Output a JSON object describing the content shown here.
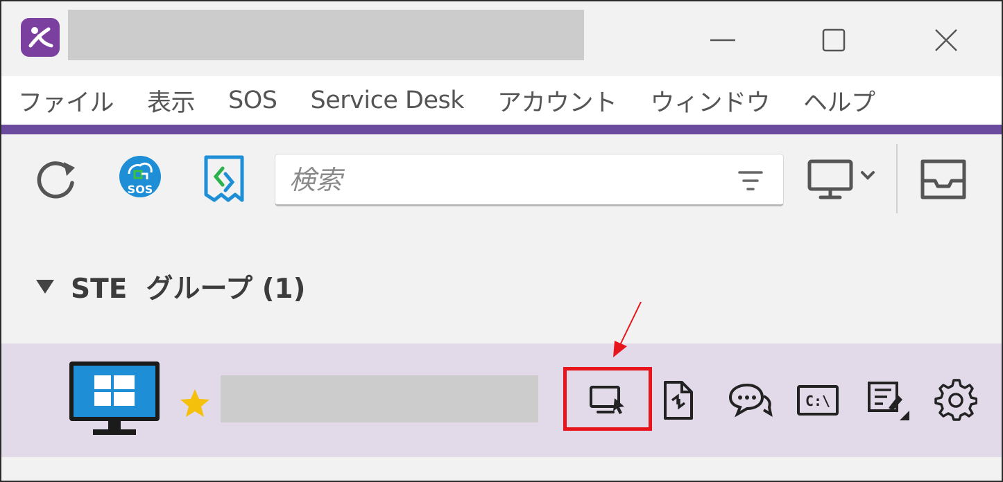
{
  "menu": {
    "items": [
      "ファイル",
      "表示",
      "SOS",
      "Service Desk",
      "アカウント",
      "ウィンドウ",
      "ヘルプ"
    ]
  },
  "toolbar": {
    "search_placeholder": "検索",
    "sos_badge": "SOS"
  },
  "group": {
    "title": "STE  グループ (1)"
  },
  "device": {
    "terminal_label": "C:\\",
    "favorite": true
  },
  "colors": {
    "accent": "#6b4b9e",
    "row_highlight": "#e2d9e9",
    "annotation": "#e8141c",
    "brand_blue": "#1e8fd6"
  },
  "icons": {
    "titlebar": [
      "app-logo",
      "minimize-icon",
      "maximize-icon",
      "close-icon"
    ],
    "toolbar": [
      "refresh-icon",
      "sos-icon",
      "connect-icon",
      "filter-icon",
      "computer-dropdown-icon",
      "inbox-icon"
    ],
    "device_actions": [
      "remote-control-icon",
      "file-transfer-icon",
      "chat-icon",
      "terminal-icon",
      "notes-icon",
      "settings-icon"
    ]
  }
}
